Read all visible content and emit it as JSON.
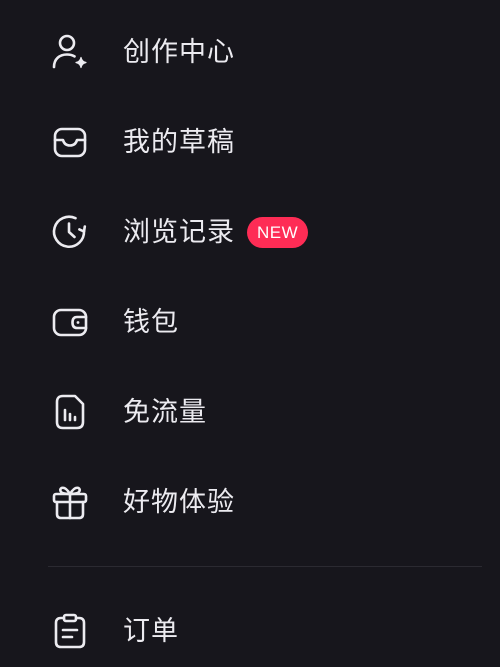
{
  "menu": {
    "items": [
      {
        "id": "creator",
        "icon": "creator-icon",
        "label": "创作中心"
      },
      {
        "id": "drafts",
        "icon": "inbox-tray-icon",
        "label": "我的草稿"
      },
      {
        "id": "history",
        "icon": "history-clock-icon",
        "label": "浏览记录",
        "badge": "NEW"
      },
      {
        "id": "wallet",
        "icon": "wallet-icon",
        "label": "钱包"
      },
      {
        "id": "free-data",
        "icon": "data-card-icon",
        "label": "免流量"
      },
      {
        "id": "product-trial",
        "icon": "gift-icon",
        "label": "好物体验"
      },
      {
        "id": "orders",
        "icon": "clipboard-icon",
        "label": "订单"
      }
    ]
  },
  "colors": {
    "background": "#17161c",
    "text": "#ecebf0",
    "badge": "#fe2c55",
    "divider": "#2b2a31"
  }
}
